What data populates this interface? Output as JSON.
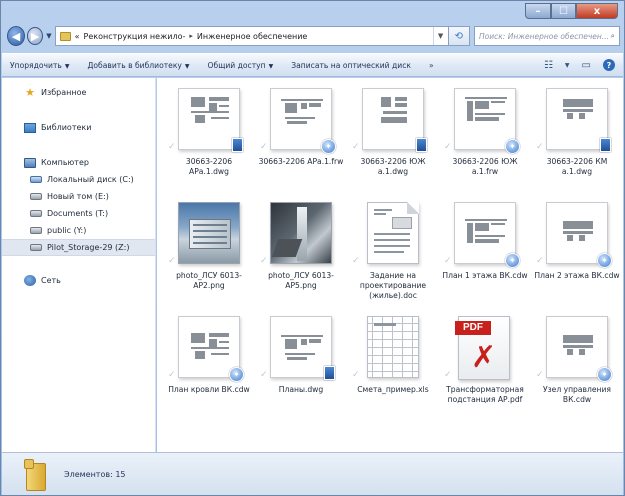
{
  "window": {
    "buttons": {
      "minimize": "–",
      "maximize": "☐",
      "close": "x"
    }
  },
  "address": {
    "prefix": "«",
    "crumbs": [
      "Реконструкция нежило-",
      "Инженерное обеспечение"
    ],
    "separator": "▸",
    "search_placeholder": "Поиск: Инженерное обеспечен..."
  },
  "toolbar": {
    "commands": [
      {
        "label": "Упорядочить"
      },
      {
        "label": "Добавить в библиотеку"
      },
      {
        "label": "Общий доступ"
      },
      {
        "label": "Записать на оптический диск"
      }
    ],
    "more": "»",
    "help": "?"
  },
  "nav": {
    "favorites": "Избранное",
    "libraries": "Библиотеки",
    "computer": "Компьютер",
    "drives": [
      "Локальный диск (C:)",
      "Новый том (E:)",
      "Documents (T:)",
      "public (Y:)",
      "Pilot_Storage-29 (Z:)"
    ],
    "network": "Сеть"
  },
  "files": [
    {
      "name": "30663-2206 АРа.1.dwg",
      "kind": "drawing",
      "badge": "dwg"
    },
    {
      "name": "30663-2206 АРа.1.frw",
      "kind": "drawing",
      "badge": "cdw"
    },
    {
      "name": "30663-2206 ЮЖ а.1.dwg",
      "kind": "drawing",
      "badge": "dwg"
    },
    {
      "name": "30663-2206 ЮЖ а.1.frw",
      "kind": "drawing",
      "badge": "cdw"
    },
    {
      "name": "30663-2206 КМ а.1.dwg",
      "kind": "drawing",
      "badge": "dwg"
    },
    {
      "name": "photo_ЛСУ 6013-АР2.png",
      "kind": "photo1",
      "badge": ""
    },
    {
      "name": "photo_ЛСУ 6013-АР5.png",
      "kind": "photo2",
      "badge": ""
    },
    {
      "name": "Задание на проектирование (жилье).doc",
      "kind": "doc",
      "badge": ""
    },
    {
      "name": "План 1 этажа ВК.cdw",
      "kind": "drawing",
      "badge": "cdw"
    },
    {
      "name": "План 2 этажа ВК.cdw",
      "kind": "drawing",
      "badge": "cdw"
    },
    {
      "name": "План кровли ВК.cdw",
      "kind": "drawing",
      "badge": "cdw"
    },
    {
      "name": "Планы.dwg",
      "kind": "drawing",
      "badge": "dwg"
    },
    {
      "name": "Смета_пример.xls",
      "kind": "sheet",
      "badge": ""
    },
    {
      "name": "Трансформаторная подстанция АР.pdf",
      "kind": "pdf",
      "badge": "",
      "pdf_label": "PDF"
    },
    {
      "name": "Узел управления ВК.cdw",
      "kind": "drawing",
      "badge": "cdw"
    }
  ],
  "status": {
    "count_text": "Элементов: 15"
  }
}
